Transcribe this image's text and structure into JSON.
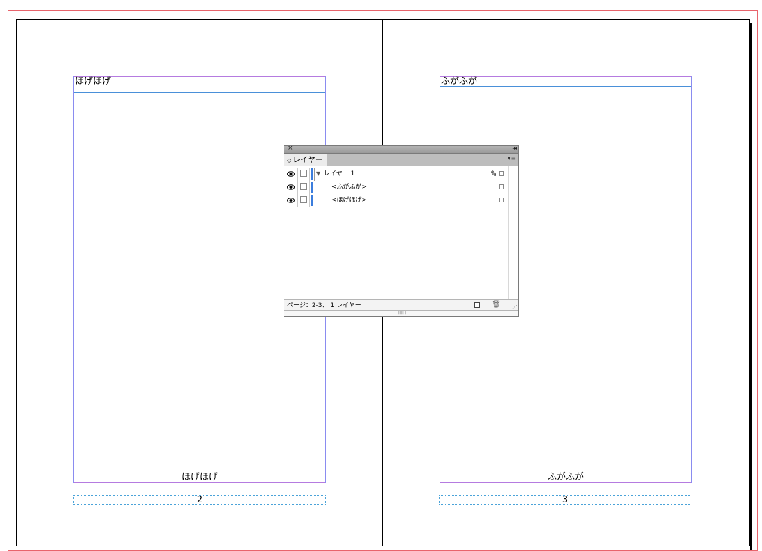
{
  "spread": {
    "left_page": {
      "running_head": "ほげほげ",
      "footer_text": "ほげほげ",
      "page_number": "2"
    },
    "right_page": {
      "running_head": "ふがふが",
      "footer_text": "ふがふが",
      "page_number": "3"
    }
  },
  "layers_panel": {
    "close_glyph": "×",
    "collapse_glyph": "◂◂",
    "tab_label": "レイヤー",
    "tab_updown": "◇",
    "menu_glyph": "▾≡",
    "layers": [
      {
        "label": "レイヤー 1",
        "expanded_glyph": "▼",
        "pen_glyph": "✎"
      },
      {
        "label": "<ふがふが>"
      },
      {
        "label": "<ほげほげ>"
      }
    ],
    "status_text": "ページ：2-3、 1 レイヤー",
    "trash_glyph": "🗑",
    "grip_glyph": "⋰",
    "resize_grip": "||||||||"
  },
  "colors": {
    "bleed": "#e8646c",
    "margin": "#b57be0",
    "frame": "#4aa3d9",
    "layer_swatch": "#3b7ddd"
  }
}
